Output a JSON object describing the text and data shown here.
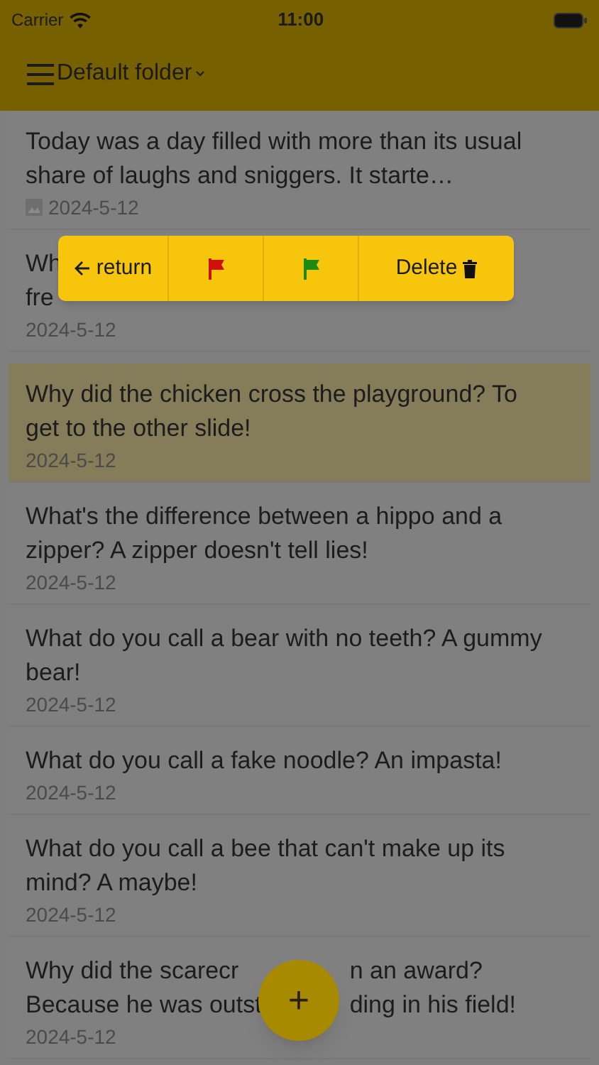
{
  "status_bar": {
    "carrier": "Carrier",
    "time": "11:00"
  },
  "header": {
    "title": "Default folder"
  },
  "notes": [
    {
      "lines": [
        "Today was a day filled with more than its usual share of laughs and sniggers. It starte…"
      ],
      "date": "2024-5-12",
      "has_image": true,
      "selected": false
    },
    {
      "lines": [
        "Wh",
        "fre"
      ],
      "date": "2024-5-12",
      "has_image": false,
      "selected": false
    },
    {
      "lines": [
        "Why did the chicken cross the playground? To get to the other slide!"
      ],
      "date": "2024-5-12",
      "has_image": false,
      "selected": true
    },
    {
      "lines": [
        "What's the difference between a hippo and a zipper? A zipper doesn't tell lies!"
      ],
      "date": "2024-5-12",
      "has_image": false,
      "selected": false
    },
    {
      "lines": [
        "What do you call a bear with no teeth? A gummy bear!"
      ],
      "date": "2024-5-12",
      "has_image": false,
      "selected": false
    },
    {
      "lines": [
        "What do you call a fake noodle? An impasta!"
      ],
      "date": "2024-5-12",
      "has_image": false,
      "selected": false
    },
    {
      "lines": [
        "What do you call a bee that can't make up its mind? A maybe!"
      ],
      "date": "2024-5-12",
      "has_image": false,
      "selected": false
    },
    {
      "lines": [
        "Why did the scarecr",
        "n an award?",
        "Because he was outst",
        "ding in his field!"
      ],
      "date": "2024-5-12",
      "has_image": false,
      "selected": false
    }
  ],
  "action_popup": {
    "buttons": [
      {
        "kind": "back",
        "label": "return"
      },
      {
        "kind": "flag",
        "color": "#d0100b"
      },
      {
        "kind": "flag",
        "color": "#1f8a10"
      },
      {
        "kind": "delete",
        "label": "Delete"
      }
    ]
  },
  "fab": {
    "label": "+"
  }
}
